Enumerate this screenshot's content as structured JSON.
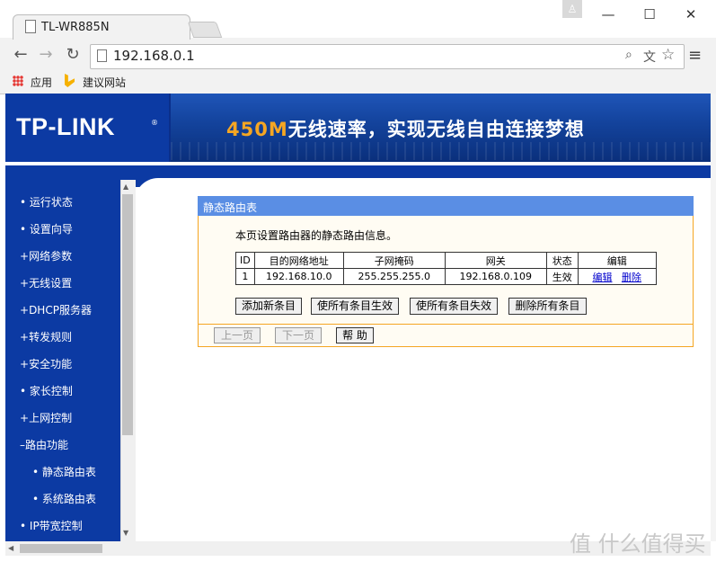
{
  "browser": {
    "tab_title": "TL-WR885N",
    "url": "192.168.0.1",
    "bookmarks": [
      {
        "label": "应用",
        "icon": "apps-icon"
      },
      {
        "label": "建议网站",
        "icon": "bing-icon"
      }
    ],
    "window_buttons": {
      "user": "♙",
      "minimize": "—",
      "maximize": "☐",
      "close": "✕"
    },
    "nav": {
      "back": "←",
      "forward": "→",
      "reload": "↻",
      "menu": "≡"
    },
    "omni_icons": {
      "zoom": "⌕",
      "translate": "文",
      "star": "☆"
    }
  },
  "header": {
    "logo": "TP-LINK",
    "logo_reg": "®",
    "slogan_highlight": "450M",
    "slogan_rest": "无线速率，实现无线自由连接梦想"
  },
  "sidebar": {
    "items": [
      {
        "label": "运行状态",
        "bullet": "•"
      },
      {
        "label": "设置向导",
        "bullet": "•"
      },
      {
        "label": "网络参数",
        "bullet": "+"
      },
      {
        "label": "无线设置",
        "bullet": "+"
      },
      {
        "label": "DHCP服务器",
        "bullet": "+"
      },
      {
        "label": "转发规则",
        "bullet": "+"
      },
      {
        "label": "安全功能",
        "bullet": "+"
      },
      {
        "label": "家长控制",
        "bullet": "•"
      },
      {
        "label": "上网控制",
        "bullet": "+"
      },
      {
        "label": "路由功能",
        "bullet": "–"
      },
      {
        "label": "静态路由表",
        "bullet": "•",
        "sub": true
      },
      {
        "label": "系统路由表",
        "bullet": "•",
        "sub": true
      },
      {
        "label": "IP带宽控制",
        "bullet": "•"
      }
    ]
  },
  "panel": {
    "title": "静态路由表",
    "description": "本页设置路由器的静态路由信息。",
    "table": {
      "headers": [
        "ID",
        "目的网络地址",
        "子网掩码",
        "网关",
        "状态",
        "编辑"
      ],
      "rows": [
        {
          "id": "1",
          "dest": "192.168.10.0",
          "mask": "255.255.255.0",
          "gateway": "192.168.0.109",
          "status": "生效",
          "edit": "编辑",
          "delete": "删除"
        }
      ]
    },
    "buttons": {
      "add": "添加新条目",
      "enable_all": "使所有条目生效",
      "disable_all": "使所有条目失效",
      "delete_all": "删除所有条目"
    },
    "paging": {
      "prev": "上一页",
      "next": "下一页",
      "help": "帮 助"
    }
  },
  "watermark": "值 什么值得买",
  "scroll": {
    "up": "▲",
    "down": "▼",
    "left": "◀"
  }
}
